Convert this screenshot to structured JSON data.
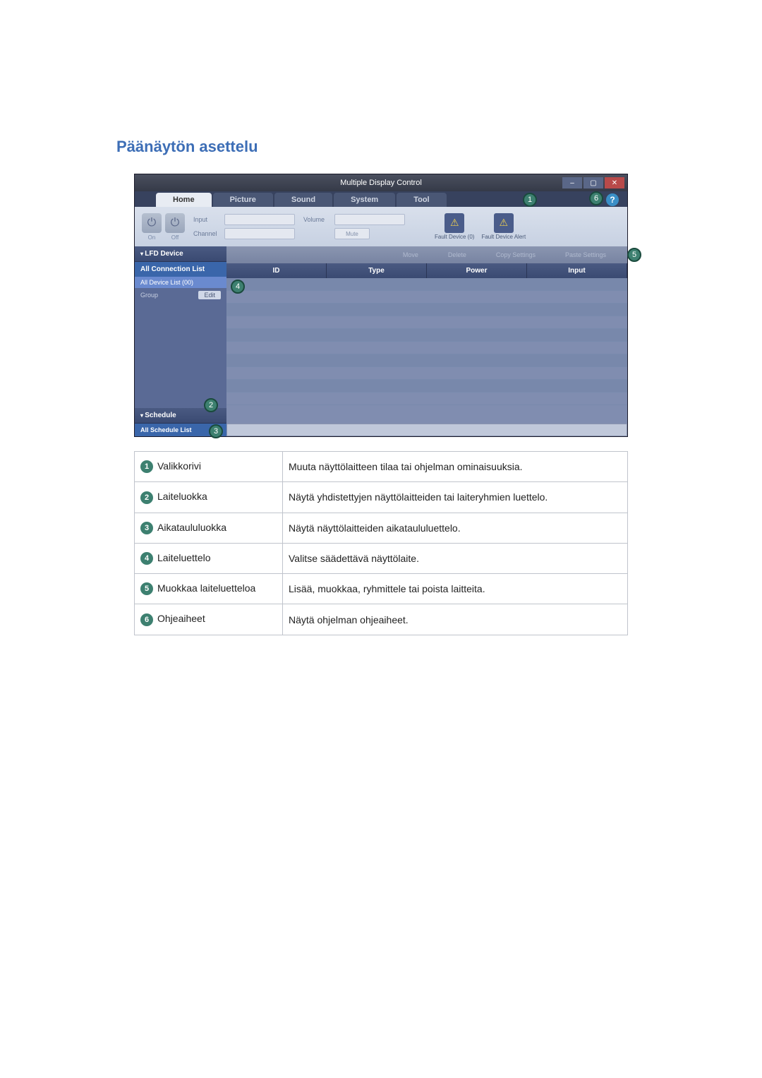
{
  "title": "Päänäytön asettelu",
  "window": {
    "title": "Multiple Display Control",
    "tabs": [
      "Home",
      "Picture",
      "Sound",
      "System",
      "Tool"
    ],
    "ribbon": {
      "power_on": "On",
      "power_off": "Off",
      "input": "Input",
      "channel": "Channel",
      "volume": "Volume",
      "mute": "Mute",
      "fault_device_0": "Fault Device\n(0)",
      "fault_device_alert": "Fault Device\nAlert"
    },
    "sidebar": {
      "lfd": "LFD Device",
      "all_conn": "All Connection List",
      "all_device": "All Device List (00)",
      "group": "Group",
      "edit": "Edit",
      "schedule": "Schedule",
      "all_schedule": "All Schedule List"
    },
    "toolbar": {
      "move": "Move",
      "delete": "Delete",
      "copy": "Copy Settings",
      "paste": "Paste Settings"
    },
    "cols": [
      "ID",
      "Type",
      "Power",
      "Input"
    ]
  },
  "callouts": {
    "c1": "1",
    "c2": "2",
    "c3": "3",
    "c4": "4",
    "c5": "5",
    "c6": "6"
  },
  "desc": [
    {
      "num": "1",
      "label": "Valikkorivi",
      "text": "Muuta näyttölaitteen tilaa tai ohjelman ominaisuuksia."
    },
    {
      "num": "2",
      "label": "Laiteluokka",
      "text": "Näytä yhdistettyjen näyttölaitteiden tai laiteryhmien luettelo."
    },
    {
      "num": "3",
      "label": "Aikataululuokka",
      "text": "Näytä näyttölaitteiden aikataululuettelo."
    },
    {
      "num": "4",
      "label": "Laiteluettelo",
      "text": "Valitse säädettävä näyttölaite."
    },
    {
      "num": "5",
      "label": "Muokkaa laiteluetteloa",
      "text": "Lisää, muokkaa, ryhmittele tai poista laitteita."
    },
    {
      "num": "6",
      "label": "Ohjeaiheet",
      "text": "Näytä ohjelman ohjeaiheet."
    }
  ]
}
